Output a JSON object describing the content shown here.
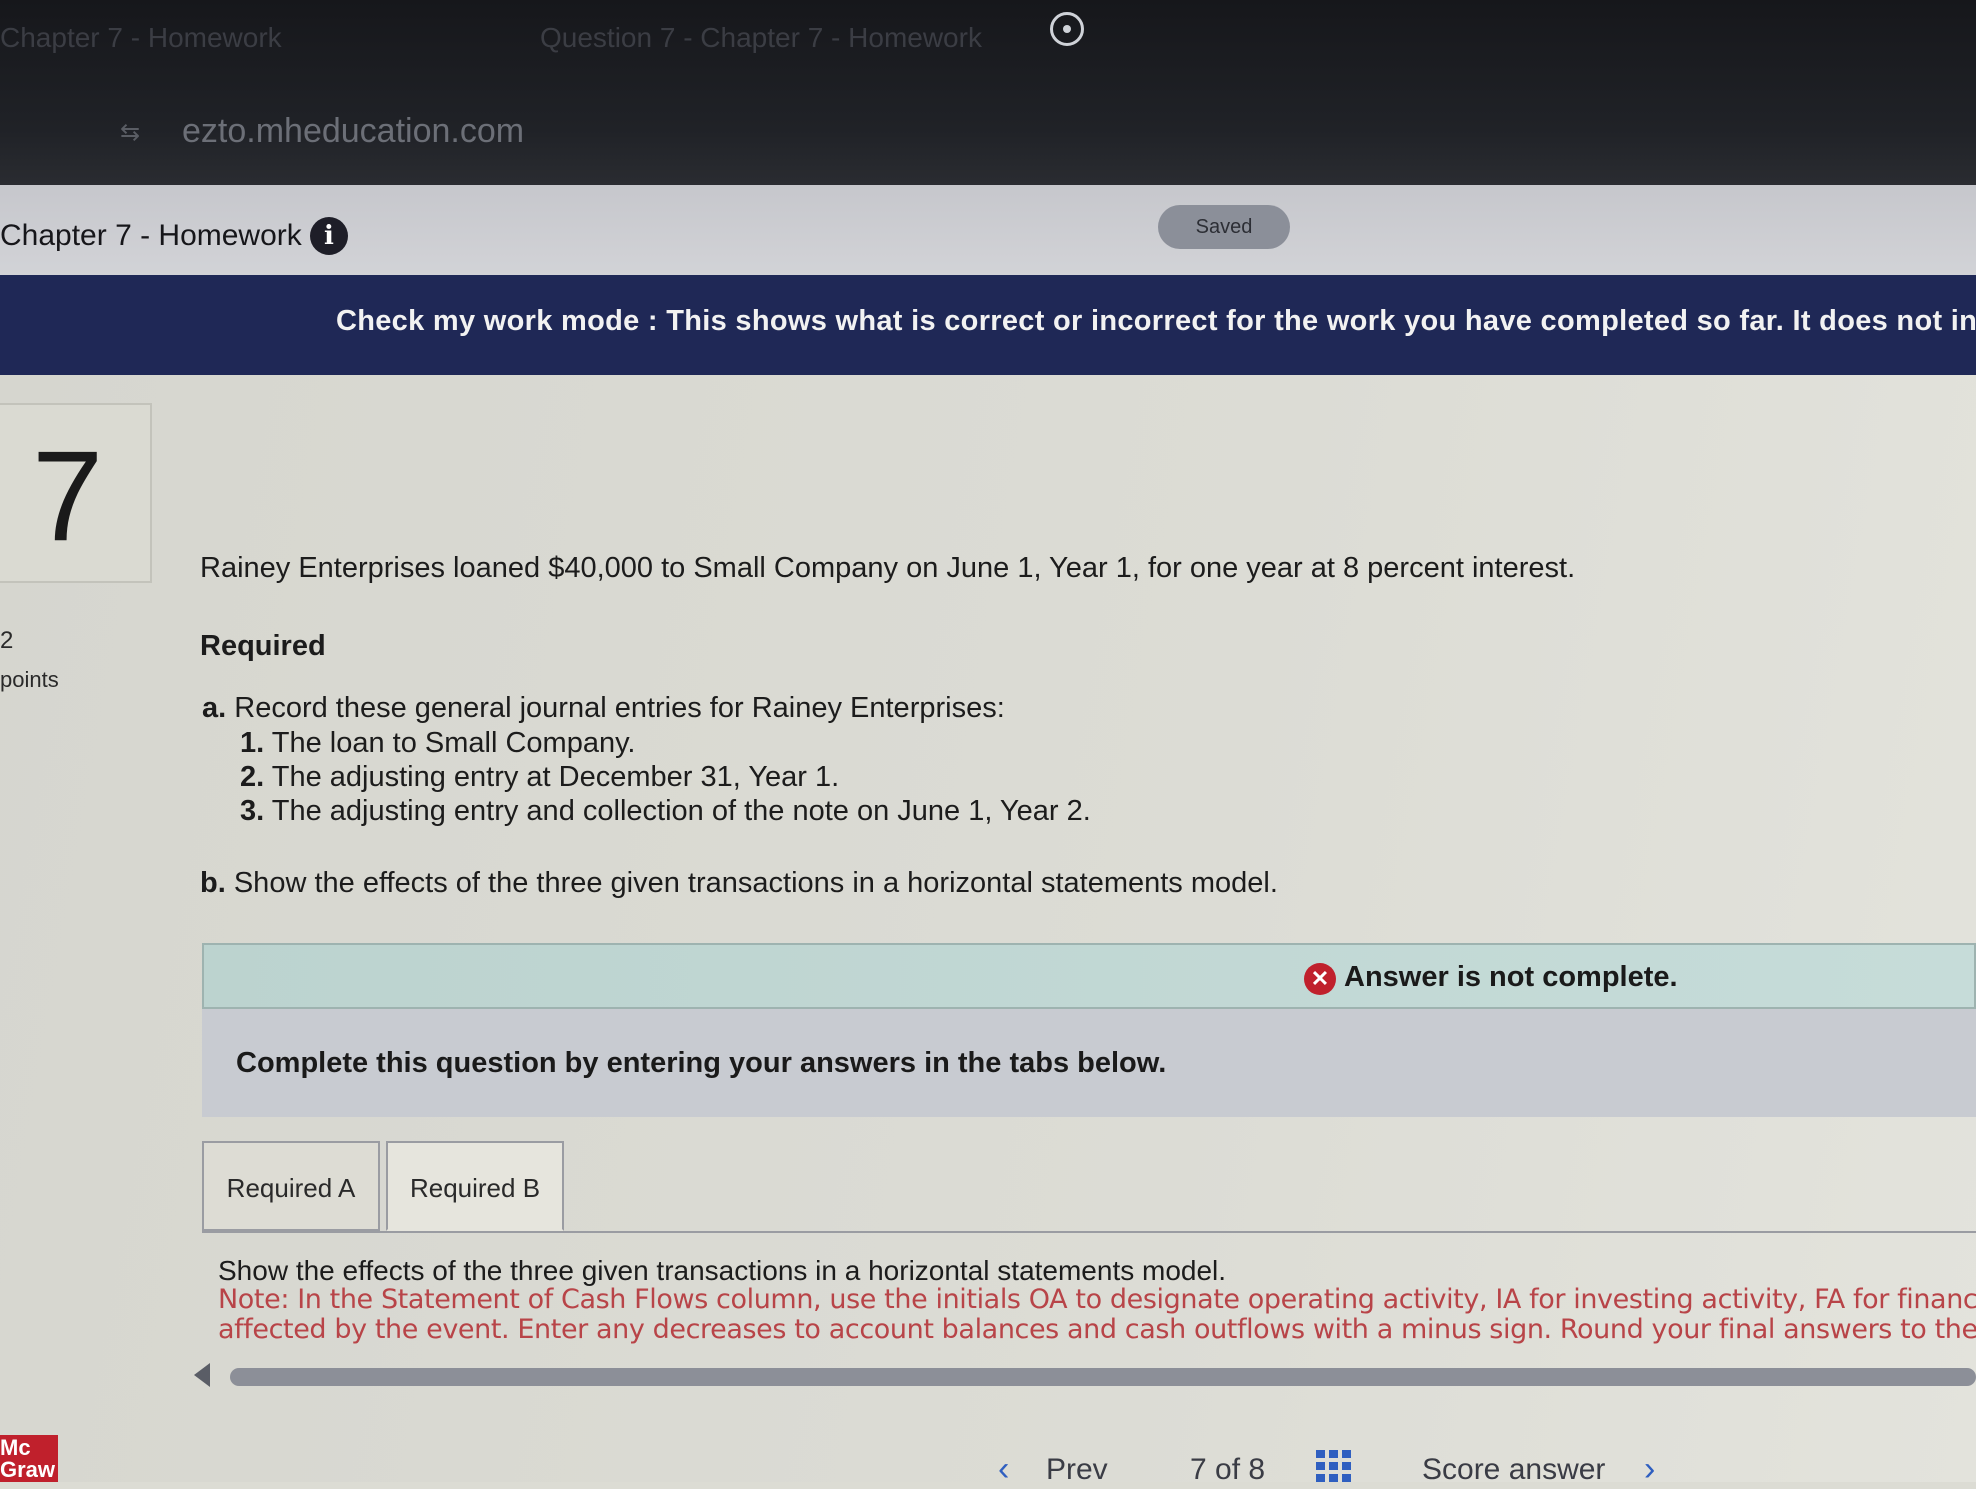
{
  "browser": {
    "tab1_title": "Chapter 7 - Homework",
    "tab2_title": "Question 7 - Chapter 7 - Homework",
    "url": "ezto.mheducation.com"
  },
  "header": {
    "title": "Chapter 7 - Homework",
    "saved_label": "Saved"
  },
  "banner": {
    "text": "Check my work mode : This shows what is correct or incorrect for the work you have completed so far. It does not indic"
  },
  "question": {
    "number": "7",
    "points_value": "2",
    "points_label": "points",
    "prompt": "Rainey Enterprises loaned $40,000 to Small Company on June 1, Year 1, for one year at 8 percent interest.",
    "required_heading": "Required",
    "item_a_letter": "a.",
    "item_a_text": "Record these general journal entries for Rainey Enterprises:",
    "sub_items": [
      {
        "num": "1.",
        "text": "The loan to Small Company."
      },
      {
        "num": "2.",
        "text": "The adjusting entry at December 31, Year 1."
      },
      {
        "num": "3.",
        "text": "The adjusting entry and collection of the note on June 1, Year 2."
      }
    ],
    "item_b_letter": "b.",
    "item_b_text": "Show the effects of the three given transactions in a horizontal statements model."
  },
  "answer_status": {
    "text": "Answer is not complete.",
    "color": "#c0202c"
  },
  "instructions": {
    "text": "Complete this question by entering your answers in the tabs below."
  },
  "tabs": [
    {
      "label": "Required A",
      "active": false
    },
    {
      "label": "Required B",
      "active": true
    }
  ],
  "tab_content": {
    "heading": "Show the effects of the three given transactions in a horizontal statements model.",
    "note_line1": "Note: In the Statement of Cash Flows column, use the initials OA to designate operating activity, IA for investing activity, FA for financing",
    "note_line2": "affected by the event. Enter any decreases to account balances and cash outflows with a minus sign. Round your final answers to the ne"
  },
  "footer": {
    "logo_line1": "Mc",
    "logo_line2": "Graw",
    "prev_label": "Prev",
    "page_current": "7",
    "page_of": "of",
    "page_total": "8",
    "score_label": "Score answer"
  },
  "colors": {
    "banner_bg": "#1f2856",
    "error_red": "#c0202c",
    "nav_blue": "#2f5fc0",
    "note_red": "#b84448"
  }
}
